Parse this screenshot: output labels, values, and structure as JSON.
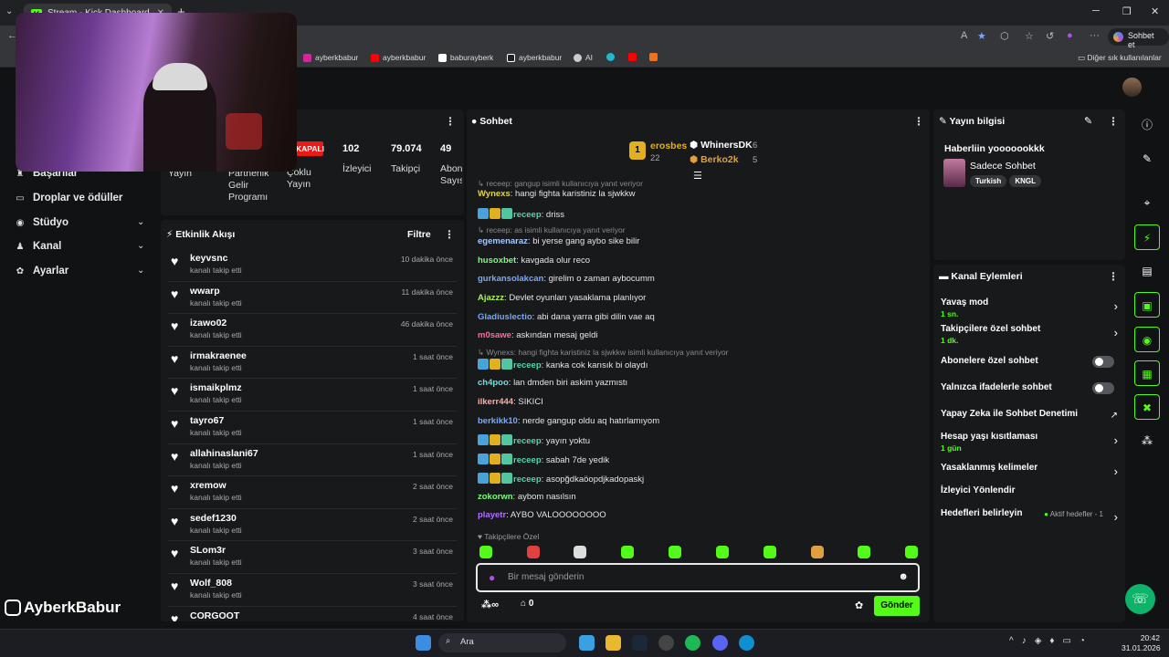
{
  "browser": {
    "tab_title": "Stream - Kick Dashboard",
    "new_tab": "+",
    "ai_button": "Sohbet et",
    "other_bookmarks": "Diğer sık kullanılanlar",
    "bookmarks": [
      "ayberkbabur",
      "ayberkbabur",
      "baburayberk",
      "ayberkbabur",
      "AI"
    ]
  },
  "sidebar": {
    "items": [
      {
        "label": "Başarılar",
        "icon": "trophy-icon"
      },
      {
        "label": "Droplar ve ödüller",
        "icon": "gift-icon"
      },
      {
        "label": "Stüdyo",
        "icon": "studio-icon"
      },
      {
        "label": "Kanal",
        "icon": "channel-icon"
      },
      {
        "label": "Ayarlar",
        "icon": "gear-icon"
      }
    ],
    "brand": "AyberkBabur"
  },
  "stats": {
    "status": "KAPALI",
    "viewers": "102",
    "viewers_label": "İzleyici",
    "followers": "79.074",
    "followers_label": "Takipçi",
    "subs": "49",
    "subs_label": "Abone Sayısı",
    "partner": "Partnerlik Gelir Programı",
    "multi": "Çoklu Yayın",
    "stream": "Yayın"
  },
  "activity": {
    "title": "Etkinlik Akışı",
    "filter": "Filtre",
    "items": [
      {
        "name": "keyvsnc",
        "sub": "kanalı takip etti",
        "time": "10 dakika önce"
      },
      {
        "name": "wwarp",
        "sub": "kanalı takip etti",
        "time": "11 dakika önce"
      },
      {
        "name": "izawo02",
        "sub": "kanalı takip etti",
        "time": "46 dakika önce"
      },
      {
        "name": "irmakraenee",
        "sub": "kanalı takip etti",
        "time": "1 saat önce"
      },
      {
        "name": "ismaikplmz",
        "sub": "kanalı takip etti",
        "time": "1 saat önce"
      },
      {
        "name": "tayro67",
        "sub": "kanalı takip etti",
        "time": "1 saat önce"
      },
      {
        "name": "allahinaslani67",
        "sub": "kanalı takip etti",
        "time": "1 saat önce"
      },
      {
        "name": "xremow",
        "sub": "kanalı takip etti",
        "time": "2 saat önce"
      },
      {
        "name": "sedef1230",
        "sub": "kanalı takip etti",
        "time": "2 saat önce"
      },
      {
        "name": "SLom3r",
        "sub": "kanalı takip etti",
        "time": "3 saat önce"
      },
      {
        "name": "Wolf_808",
        "sub": "kanalı takip etti",
        "time": "3 saat önce"
      },
      {
        "name": "CORGOOT",
        "sub": "",
        "time": "4 saat önce"
      }
    ]
  },
  "chat": {
    "title": "Sohbet",
    "leaderboard": [
      {
        "name": "erosbes",
        "count": "22"
      },
      {
        "name": "WhinersDK",
        "count": "6"
      },
      {
        "name": "Berko2k",
        "count": "5"
      }
    ],
    "messages": [
      {
        "reply": "receep: gangup isimli kullanıcıya yanıt veriyor"
      },
      {
        "user": "Wynexs",
        "color": "#e0d44f",
        "text": "hangi fighta karistiniz la sjwkkw"
      },
      {
        "user": "receep",
        "color": "#53d6a8",
        "badges": true,
        "text": "driss"
      },
      {
        "reply": "receep: as isimli kullanıcıya yanıt veriyor"
      },
      {
        "user": "egemenaraz",
        "color": "#a8c8ff",
        "text": "bi yerse gang aybo sike bilir"
      },
      {
        "user": "husoxbet",
        "color": "#7cfc7c",
        "text": "kavgada olur reco"
      },
      {
        "user": "gurkansolakcan",
        "color": "#7aa8ff",
        "text": "girelim o zaman aybocumm"
      },
      {
        "user": "Ajazzz",
        "color": "#b0f060",
        "text": "Devlet oyunları yasaklama planlıyor"
      },
      {
        "user": "Gladiuslectio",
        "color": "#6fa8ff",
        "text": "abi dana yarra gibi dilin vae aq"
      },
      {
        "user": "m0sawe",
        "color": "#ff6b9a",
        "text": "askından mesaj geldi"
      },
      {
        "reply": "Wynexs: hangi fighta karistiniz la sjwkkw isimli kullanıcıya yanıt veriyor"
      },
      {
        "user": "receep",
        "color": "#53d6a8",
        "badges": true,
        "text": "kanka cok karısık bi olaydı"
      },
      {
        "user": "ch4poo",
        "color": "#6ee0e0",
        "text": "lan dmden biri askim yazmıstı"
      },
      {
        "user": "ilkerr444",
        "color": "#f0b0b0",
        "text": "SIKICI"
      },
      {
        "user": "berkikk10",
        "color": "#7aa8ff",
        "text": "nerde gangup oldu aq hatırlamıyom"
      },
      {
        "user": "receep",
        "color": "#53d6a8",
        "badges": true,
        "text": "yayın yoktu"
      },
      {
        "user": "receep",
        "color": "#53d6a8",
        "badges": true,
        "text": "sabah 7de yedik"
      },
      {
        "user": "receep",
        "color": "#53d6a8",
        "badges": true,
        "text": "asopğdkaöopdjkadopaskj"
      },
      {
        "user": "zokorwn",
        "color": "#7cfc7c",
        "text": "aybom nasılsın"
      },
      {
        "user": "playetr",
        "color": "#b070ff",
        "text": "AYBO VALOOOOOOOO"
      }
    ],
    "followers_only": "Takipçilere Özel",
    "input_placeholder": "Bir mesaj gönderin",
    "points": "∞",
    "store": "0",
    "send": "Gönder"
  },
  "stream_info": {
    "title": "Yayın bilgisi",
    "stream_title": "Haberliin yooooookkk",
    "category": "Sadece Sohbet",
    "tags": [
      "Turkish",
      "KNGL"
    ]
  },
  "channel_actions": {
    "title": "Kanal Eylemleri",
    "rows": [
      {
        "label": "Yavaş mod",
        "sub": "1 sn."
      },
      {
        "label": "Takipçilere özel sohbet",
        "sub": "1 dk."
      },
      {
        "label": "Abonelere özel sohbet",
        "sub": ""
      },
      {
        "label": "Yalnızca ifadelerle sohbet",
        "sub": ""
      },
      {
        "label": "Yapay Zeka ile Sohbet Denetimi",
        "sub": ""
      },
      {
        "label": "Hesap yaşı kısıtlaması",
        "sub": "1 gün"
      },
      {
        "label": "Yasaklanmış kelimeler",
        "sub": ""
      },
      {
        "label": "İzleyici Yönlendir",
        "sub": ""
      },
      {
        "label": "Hedefleri belirleyin",
        "sub": "",
        "status": "Aktif hedefler - 1"
      }
    ]
  },
  "taskbar": {
    "search": "Ara",
    "time": "20:42",
    "date": "31.01.2026"
  },
  "colors": {
    "kick_green": "#53fc18",
    "live_red": "#e91916"
  }
}
